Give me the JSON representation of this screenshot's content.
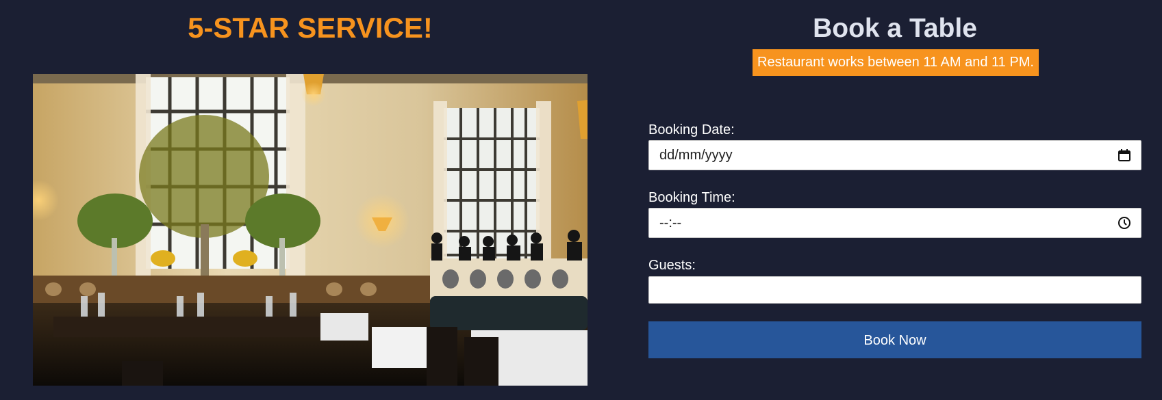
{
  "left_panel": {
    "title": "5-STAR SERVICE!",
    "photo_subject": "restaurant dining room with tall windows, floral centerpiece and set tables"
  },
  "booking": {
    "title": "Book a Table",
    "hours_notice": "Restaurant works between 11 AM and 11 PM.",
    "date": {
      "label": "Booking Date:",
      "placeholder": "dd/mm/yyyy",
      "icon": "calendar-icon"
    },
    "time": {
      "label": "Booking Time:",
      "placeholder": "--:--",
      "icon": "clock-icon"
    },
    "guests": {
      "label": "Guests:",
      "value": ""
    },
    "submit_label": "Book Now"
  },
  "colors": {
    "background": "#1b1f33",
    "accent_orange": "#f7931e",
    "button_blue": "#27569a",
    "heading_light": "#dfe3ee"
  }
}
